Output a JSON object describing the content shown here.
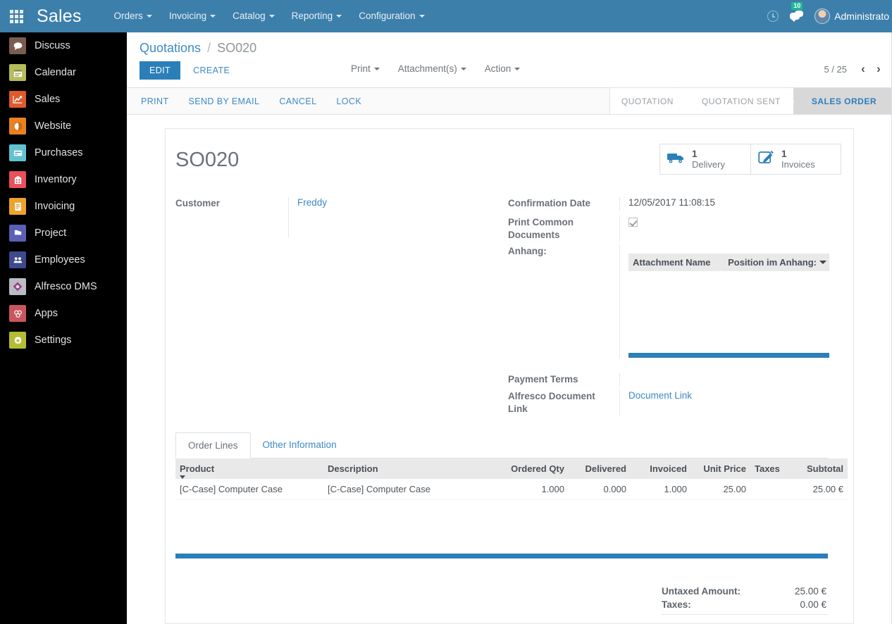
{
  "navbar": {
    "apps_icon": "apps-grid-icon",
    "brand": "Sales",
    "menus": [
      {
        "label": "Orders"
      },
      {
        "label": "Invoicing"
      },
      {
        "label": "Catalog"
      },
      {
        "label": "Reporting"
      },
      {
        "label": "Configuration"
      }
    ],
    "clock_icon": "clock-icon",
    "messages_icon": "messages-icon",
    "messages_count": "10",
    "user_name": "Administrato",
    "accent": "#3d7fab"
  },
  "sidebar": {
    "items": [
      {
        "label": "Discuss",
        "icon": "discuss-icon",
        "color": "#7a5c52"
      },
      {
        "label": "Calendar",
        "icon": "calendar-icon",
        "color": "#b5bd5a"
      },
      {
        "label": "Sales",
        "icon": "sales-icon",
        "color": "#e05a2b"
      },
      {
        "label": "Website",
        "icon": "website-icon",
        "color": "#e9821f"
      },
      {
        "label": "Purchases",
        "icon": "purchases-icon",
        "color": "#62c3d0"
      },
      {
        "label": "Inventory",
        "icon": "inventory-icon",
        "color": "#e8505b"
      },
      {
        "label": "Invoicing",
        "icon": "invoicing-icon",
        "color": "#eda22a"
      },
      {
        "label": "Project",
        "icon": "project-icon",
        "color": "#5b60b5"
      },
      {
        "label": "Employees",
        "icon": "employees-icon",
        "color": "#3e4a8c"
      },
      {
        "label": "Alfresco DMS",
        "icon": "alfresco-dms-icon",
        "color": "#b9bcc0"
      },
      {
        "label": "Apps",
        "icon": "apps-icon",
        "color": "#c8565f"
      },
      {
        "label": "Settings",
        "icon": "settings-icon",
        "color": "#b5bd35"
      }
    ]
  },
  "control_panel": {
    "breadcrumb_root": "Quotations",
    "breadcrumb_sep": "/",
    "breadcrumb_current": "SO020",
    "edit_label": "EDIT",
    "create_label": "CREATE",
    "dropdowns": [
      {
        "label": "Print"
      },
      {
        "label": "Attachment(s)"
      },
      {
        "label": "Action"
      }
    ],
    "pager_value": "5 / 25",
    "pager_prev": "‹",
    "pager_next": "›"
  },
  "statusbar": {
    "buttons": [
      {
        "label": "PRINT"
      },
      {
        "label": "SEND BY EMAIL"
      },
      {
        "label": "CANCEL"
      },
      {
        "label": "LOCK"
      }
    ],
    "stages": [
      {
        "label": "QUOTATION",
        "active": false
      },
      {
        "label": "QUOTATION SENT",
        "active": false
      },
      {
        "label": "SALES ORDER",
        "active": true
      }
    ]
  },
  "form": {
    "title": "SO020",
    "smart_buttons": [
      {
        "count": "1",
        "label": "Delivery",
        "icon": "truck-icon"
      },
      {
        "count": "1",
        "label": "Invoices",
        "icon": "pencil-square-icon"
      }
    ],
    "left_fields": [
      {
        "label": "Customer",
        "value": "Freddy",
        "type": "link"
      }
    ],
    "right_fields": {
      "confirmation_date_label": "Confirmation Date",
      "confirmation_date_value": "12/05/2017 11:08:15",
      "print_common_documents_label": "Print Common Documents",
      "print_common_documents_checked": true,
      "anhang_label": "Anhang:",
      "attachment_columns": [
        "Attachment Name",
        "Position im Anhang:"
      ],
      "payment_terms_label": "Payment Terms",
      "payment_terms_value": "",
      "alfresco_label": "Alfresco Document Link",
      "alfresco_value": "Document Link"
    }
  },
  "notebook": {
    "tabs": [
      {
        "label": "Order Lines",
        "active": true
      },
      {
        "label": "Other Information",
        "active": false
      }
    ],
    "columns": [
      "Product",
      "Description",
      "Ordered Qty",
      "Delivered",
      "Invoiced",
      "Unit Price",
      "Taxes",
      "Subtotal"
    ],
    "rows": [
      {
        "product": "[C-Case] Computer Case",
        "description": "[C-Case] Computer Case",
        "ordered_qty": "1.000",
        "delivered": "0.000",
        "invoiced": "1.000",
        "unit_price": "25.00",
        "taxes": "",
        "subtotal": "25.00 €"
      }
    ],
    "totals": [
      {
        "label": "Untaxed Amount:",
        "value": "25.00 €"
      },
      {
        "label": "Taxes:",
        "value": "0.00 €"
      }
    ]
  }
}
